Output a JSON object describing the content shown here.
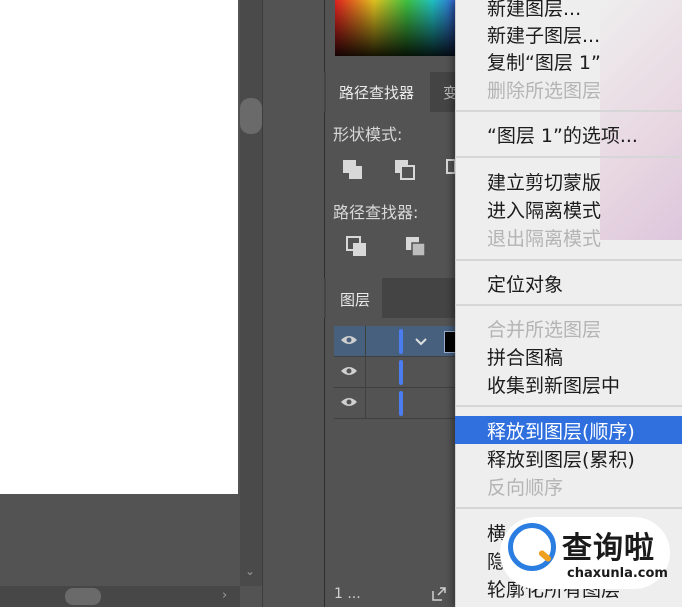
{
  "pathfinder_panel": {
    "tab_label": "路径查找器",
    "next_tab_label": "变",
    "shape_modes_label": "形状模式:",
    "pathfinders_label": "路径查找器:"
  },
  "layers_panel": {
    "tab_label": "图层",
    "footer_count": "1 ..."
  },
  "context_menu": {
    "items": [
      {
        "label": "新建图层...",
        "disabled": false
      },
      {
        "label": "新建子图层...",
        "disabled": false
      },
      {
        "label": "复制“图层 1”",
        "disabled": false
      },
      {
        "label": "删除所选图层",
        "disabled": true
      },
      {
        "label": "“图层 1”的选项...",
        "disabled": false
      },
      {
        "label": "建立剪切蒙版",
        "disabled": false
      },
      {
        "label": "进入隔离模式",
        "disabled": false
      },
      {
        "label": "退出隔离模式",
        "disabled": true
      },
      {
        "label": "定位对象",
        "disabled": false
      },
      {
        "label": "合并所选图层",
        "disabled": true
      },
      {
        "label": "拼合图稿",
        "disabled": false
      },
      {
        "label": "收集到新图层中",
        "disabled": false
      },
      {
        "label": "释放到图层(顺序)",
        "disabled": false,
        "highlighted": true
      },
      {
        "label": "释放到图层(累积)",
        "disabled": false
      },
      {
        "label": "反向顺序",
        "disabled": true
      },
      {
        "label": "横",
        "disabled": false
      },
      {
        "label": "隐",
        "disabled": false
      },
      {
        "label": "轮廓化所有图层",
        "disabled": false
      }
    ]
  },
  "watermark": {
    "text": "查询啦",
    "url": "chaxunla.com"
  },
  "colors": {
    "selection_blue": "#2f6fde",
    "layer_bar_blue": "#4b7cf0",
    "panel_bg": "#535353",
    "menu_bg": "#eeeeee"
  },
  "icons": [
    "eye-icon",
    "chevron-down-icon",
    "unite-icon",
    "minus-front-icon",
    "divide-icon",
    "trim-icon",
    "export-icon"
  ]
}
